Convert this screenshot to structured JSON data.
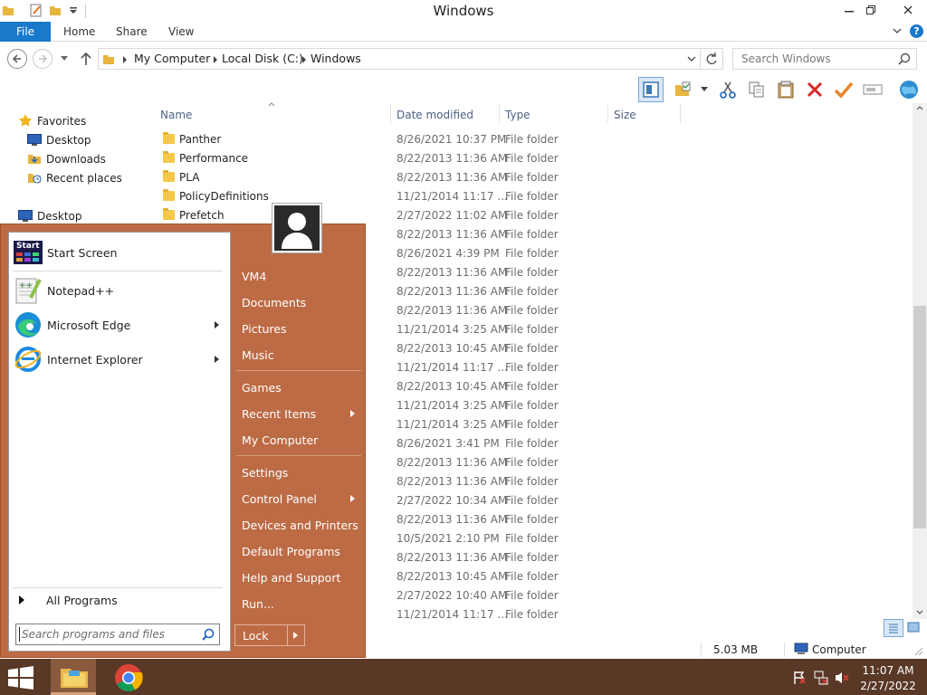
{
  "window": {
    "title": "Windows"
  },
  "ribbon": {
    "file": "File",
    "tabs": [
      "Home",
      "Share",
      "View"
    ]
  },
  "address": {
    "crumbs": [
      "My Computer",
      "Local Disk (C:)",
      "Windows"
    ],
    "search_placeholder": "Search Windows"
  },
  "nav": {
    "favorites": "Favorites",
    "items": [
      "Desktop",
      "Downloads",
      "Recent places"
    ],
    "desktop": "Desktop"
  },
  "columns": {
    "name": "Name",
    "date": "Date modified",
    "type": "Type",
    "size": "Size"
  },
  "files": [
    {
      "name": "Panther",
      "date": "8/26/2021 10:37 PM",
      "type": "File folder"
    },
    {
      "name": "Performance",
      "date": "8/22/2013 11:36 AM",
      "type": "File folder"
    },
    {
      "name": "PLA",
      "date": "8/22/2013 11:36 AM",
      "type": "File folder"
    },
    {
      "name": "PolicyDefinitions",
      "date": "11/21/2014 11:17 ...",
      "type": "File folder"
    },
    {
      "name": "Prefetch",
      "date": "2/27/2022 11:02 AM",
      "type": "File folder"
    },
    {
      "name": "",
      "date": "8/22/2013 11:36 AM",
      "type": "File folder"
    },
    {
      "name": "",
      "date": "8/26/2021 4:39 PM",
      "type": "File folder"
    },
    {
      "name": "",
      "date": "8/22/2013 11:36 AM",
      "type": "File folder"
    },
    {
      "name": "",
      "date": "8/22/2013 11:36 AM",
      "type": "File folder"
    },
    {
      "name": "",
      "date": "8/22/2013 11:36 AM",
      "type": "File folder"
    },
    {
      "name": "",
      "date": "11/21/2014 3:25 AM",
      "type": "File folder"
    },
    {
      "name": "",
      "date": "8/22/2013 10:45 AM",
      "type": "File folder"
    },
    {
      "name": "",
      "date": "11/21/2014 11:17 ...",
      "type": "File folder"
    },
    {
      "name": "",
      "date": "8/22/2013 10:45 AM",
      "type": "File folder"
    },
    {
      "name": "",
      "date": "11/21/2014 3:25 AM",
      "type": "File folder"
    },
    {
      "name": "",
      "date": "11/21/2014 3:25 AM",
      "type": "File folder"
    },
    {
      "name": "",
      "date": "8/26/2021 3:41 PM",
      "type": "File folder"
    },
    {
      "name": "",
      "date": "8/22/2013 11:36 AM",
      "type": "File folder"
    },
    {
      "name": "",
      "date": "8/22/2013 11:36 AM",
      "type": "File folder"
    },
    {
      "name": "",
      "date": "2/27/2022 10:34 AM",
      "type": "File folder"
    },
    {
      "name": "",
      "date": "8/22/2013 11:36 AM",
      "type": "File folder"
    },
    {
      "name": "",
      "date": "10/5/2021 2:10 PM",
      "type": "File folder"
    },
    {
      "name": "",
      "date": "8/22/2013 11:36 AM",
      "type": "File folder"
    },
    {
      "name": "",
      "date": "8/22/2013 10:45 AM",
      "type": "File folder"
    },
    {
      "name": "",
      "date": "2/27/2022 10:40 AM",
      "type": "File folder"
    },
    {
      "name": "",
      "date": "11/21/2014 11:17 ...",
      "type": "File folder"
    }
  ],
  "start_menu": {
    "programs": [
      "Start Screen",
      "Notepad++",
      "Microsoft Edge",
      "Internet Explorer"
    ],
    "start_tile_text": "Start",
    "all_programs": "All Programs",
    "search_placeholder": "Search programs and files",
    "links": [
      "VM4",
      "Documents",
      "Pictures",
      "Music",
      "Games",
      "Recent Items",
      "My Computer",
      "Settings",
      "Control Panel",
      "Devices and Printers",
      "Default Programs",
      "Help and Support",
      "Run..."
    ],
    "lock": "Lock",
    "accent": "#bd6b45"
  },
  "status": {
    "size": "5.03 MB",
    "location": "Computer"
  },
  "taskbar": {
    "time": "11:07 AM",
    "date": "2/27/2022"
  }
}
